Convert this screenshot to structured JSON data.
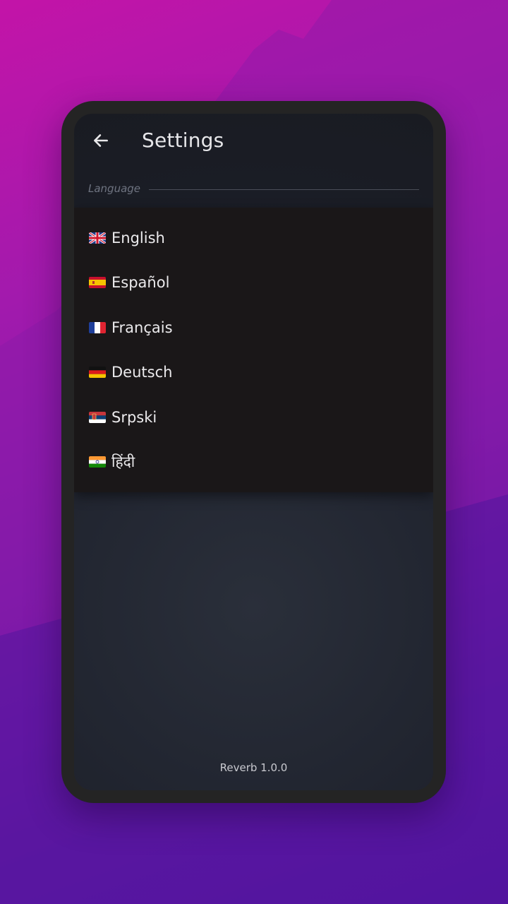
{
  "colors": {
    "phone_frame": "#242424",
    "screen_bg": "#1b1e27",
    "menu_bg": "#1a1718",
    "text_primary": "#ebeaec",
    "text_muted": "#6e7380"
  },
  "appbar": {
    "back_icon": "arrow-left-icon",
    "title": "Settings"
  },
  "section": {
    "label": "Language"
  },
  "languages": [
    {
      "flag": "uk-flag-icon",
      "label": "English"
    },
    {
      "flag": "spain-flag-icon",
      "label": "Español"
    },
    {
      "flag": "france-flag-icon",
      "label": "Français"
    },
    {
      "flag": "germany-flag-icon",
      "label": "Deutsch"
    },
    {
      "flag": "serbia-flag-icon",
      "label": "Srpski"
    },
    {
      "flag": "india-flag-icon",
      "label": "हिंदी"
    }
  ],
  "footer": {
    "version": "Reverb 1.0.0"
  }
}
